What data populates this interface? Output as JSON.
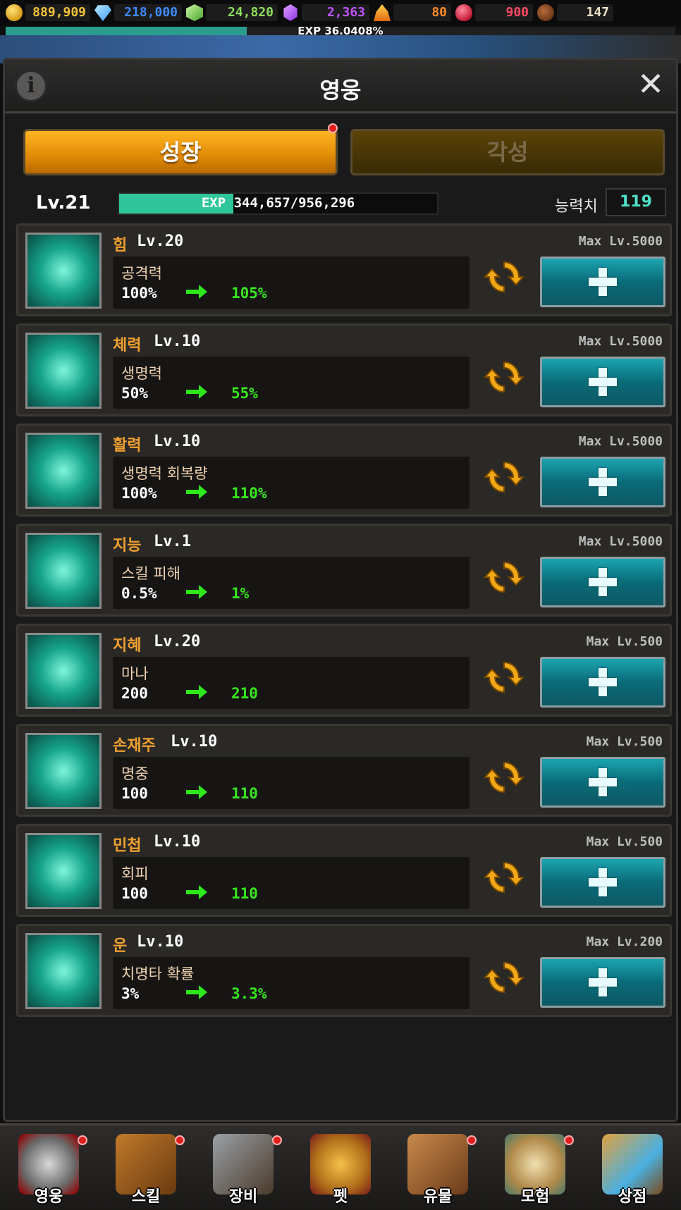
{
  "currencies": [
    {
      "name": "gold-icon",
      "value": "889,909",
      "color": "#f2c23a",
      "width": 92
    },
    {
      "name": "diamond-icon",
      "value": "218,000",
      "color": "#3d8bff",
      "width": 96
    },
    {
      "name": "emerald-icon",
      "value": "24,820",
      "color": "#8edb5a",
      "width": 102
    },
    {
      "name": "amethyst-icon",
      "value": "2,363",
      "color": "#c052ff",
      "width": 96
    },
    {
      "name": "fire-crystal-icon",
      "value": "80",
      "color": "#ff8a2a",
      "width": 82
    },
    {
      "name": "ruby-icon",
      "value": "900",
      "color": "#ff4a66",
      "width": 82
    },
    {
      "name": "meat-icon",
      "value": "147",
      "color": "#f1e2c6",
      "width": 80
    }
  ],
  "top_exp": {
    "label": "EXP 36.0408%",
    "progress": 0.36
  },
  "panel": {
    "title": "영웅"
  },
  "tabs": {
    "growth": "성장",
    "awakening": "각성"
  },
  "hero": {
    "level": "Lv.21",
    "exp_text": "EXP 344,657/956,296",
    "exp_progress": 0.36,
    "stat_label": "능력치",
    "stat_points": "119"
  },
  "stats": [
    {
      "name": "힘",
      "level": "Lv.20",
      "max": "Max Lv.5000",
      "stat": "공격력",
      "current": "100%",
      "next": "105%",
      "icon": "fist-icon"
    },
    {
      "name": "체력",
      "level": "Lv.10",
      "max": "Max Lv.5000",
      "stat": "생명력",
      "current": "50%",
      "next": "55%",
      "icon": "body-heart-icon"
    },
    {
      "name": "활력",
      "level": "Lv.10",
      "max": "Max Lv.5000",
      "stat": "생명력 회복량",
      "current": "100%",
      "next": "110%",
      "icon": "healing-cross-icon"
    },
    {
      "name": "지능",
      "level": "Lv.1",
      "max": "Max Lv.5000",
      "stat": "스킬 피해",
      "current": "0.5%",
      "next": "1%",
      "icon": "tribal-mask-icon"
    },
    {
      "name": "지혜",
      "level": "Lv.20",
      "max": "Max Lv.500",
      "stat": "마나",
      "current": "200",
      "next": "210",
      "icon": "brain-head-icon"
    },
    {
      "name": "손재주",
      "level": "Lv.10",
      "max": "Max Lv.500",
      "stat": "명중",
      "current": "100",
      "next": "110",
      "icon": "shield-strike-icon"
    },
    {
      "name": "민첩",
      "level": "Lv.10",
      "max": "Max Lv.500",
      "stat": "회피",
      "current": "100",
      "next": "110",
      "icon": "dodge-figure-icon"
    },
    {
      "name": "운",
      "level": "Lv.10",
      "max": "Max Lv.200",
      "stat": "치명타 확률",
      "current": "3%",
      "next": "3.3%",
      "icon": "clover-icon"
    }
  ],
  "nav": [
    {
      "label": "영웅",
      "icon": "knight-helmet-icon",
      "dot": true
    },
    {
      "label": "스킬",
      "icon": "skill-book-icon",
      "dot": true
    },
    {
      "label": "장비",
      "icon": "sword-shield-icon",
      "dot": true
    },
    {
      "label": "펫",
      "icon": "pet-creature-icon",
      "dot": false
    },
    {
      "label": "유물",
      "icon": "relic-chest-icon",
      "dot": true
    },
    {
      "label": "모험",
      "icon": "compass-map-icon",
      "dot": true
    },
    {
      "label": "상점",
      "icon": "treasure-chest-icon",
      "dot": false
    }
  ]
}
